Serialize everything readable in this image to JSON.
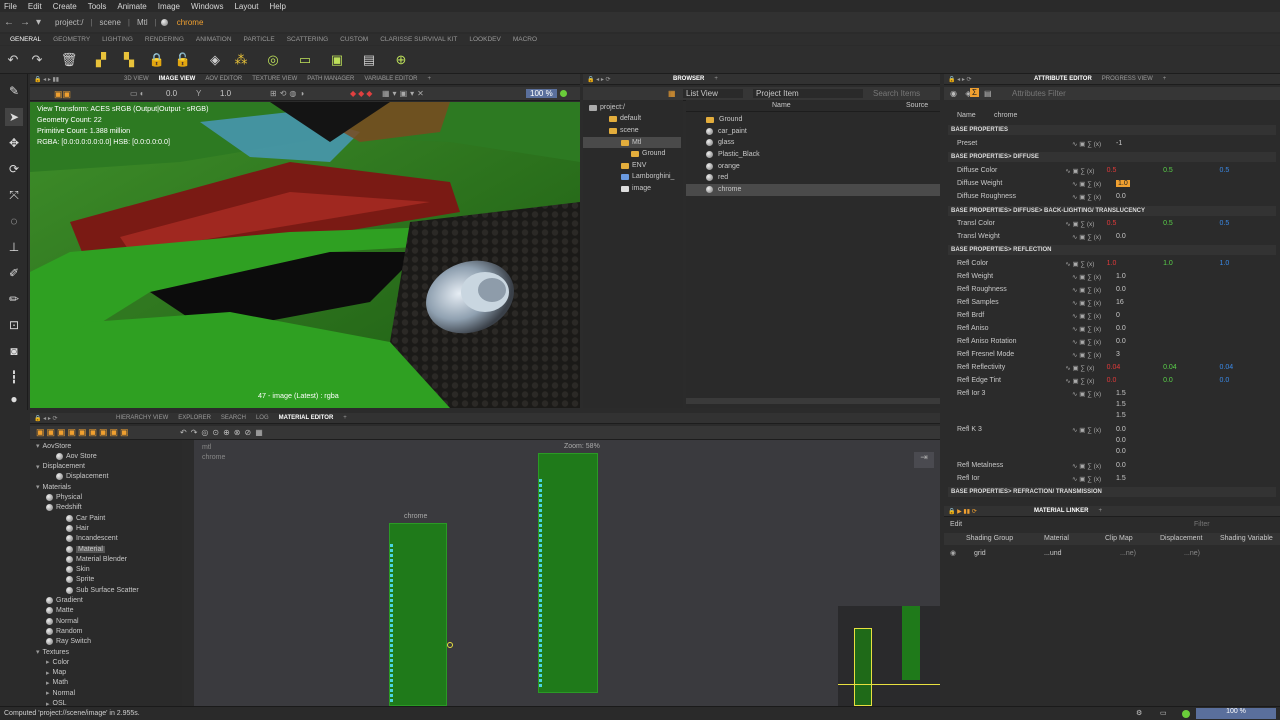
{
  "menu": [
    "File",
    "Edit",
    "Create",
    "Tools",
    "Animate",
    "Image",
    "Windows",
    "Layout",
    "Help"
  ],
  "path": {
    "crumbs": [
      "project:/",
      "scene",
      "Mtl"
    ],
    "selected": "chrome"
  },
  "shelf_tabs": [
    "GENERAL",
    "GEOMETRY",
    "LIGHTING",
    "RENDERING",
    "ANIMATION",
    "PARTICLE",
    "SCATTERING",
    "CUSTOM",
    "CLARISSE SURVIVAL KIT",
    "LOOKDEV",
    "MACRO"
  ],
  "viewport": {
    "tabs": [
      "3D VIEW",
      "IMAGE VIEW",
      "AOV EDITOR",
      "TEXTURE VIEW",
      "PATH MANAGER",
      "VARIABLE EDITOR"
    ],
    "field1": "0.0",
    "field2": "1.0",
    "zoom": "100 %",
    "info_lines": [
      "View Transform: ACES sRGB (Output|Output - sRGB)",
      "Geometry Count: 22",
      "Primitive Count: 1.388 million",
      "RGBA: [0.0:0.0:0.0:0.0] HSB: [0.0:0.0:0.0]"
    ],
    "caption": "47 - image (Latest) : rgba"
  },
  "browser": {
    "tab": "BROWSER",
    "list_view": "List View",
    "project_item": "Project Item",
    "search_placeholder": "Search Items",
    "col_name": "Name",
    "col_source": "Source",
    "tree": [
      "project:/",
      "default",
      "scene",
      "Mtl",
      "Ground",
      "ENV",
      "Lamborghini_",
      "image"
    ],
    "items": [
      "Ground",
      "car_paint",
      "glass",
      "Plastic_Black",
      "orange",
      "red",
      "chrome"
    ]
  },
  "attr": {
    "tabs": [
      "ATTRIBUTE EDITOR",
      "PROGRESS VIEW"
    ],
    "filter_placeholder": "Attributes Filter",
    "name_label": "Name",
    "name_value": "chrome",
    "sections": [
      "BASE PROPERTIES",
      "BASE PROPERTIES> DIFFUSE",
      "BASE PROPERTIES> DIFFUSE> BACK-LIGHTING/ TRANSLUCENCY",
      "BASE PROPERTIES> REFLECTION",
      "BASE PROPERTIES> REFRACTION/ TRANSMISSION"
    ],
    "rows": [
      {
        "label": "Preset",
        "v": "-1"
      },
      {
        "label": "Diffuse Color",
        "r": "0.5",
        "g": "0.5",
        "b": "0.5"
      },
      {
        "label": "Diffuse Weight",
        "v": "1.0"
      },
      {
        "label": "Diffuse Roughness",
        "v": "0.0"
      },
      {
        "label": "Transl Color",
        "r": "0.5",
        "g": "0.5",
        "b": "0.5"
      },
      {
        "label": "Transl Weight",
        "v": "0.0"
      },
      {
        "label": "Refl Color",
        "r": "1.0",
        "g": "1.0",
        "b": "1.0"
      },
      {
        "label": "Refl Weight",
        "v": "1.0"
      },
      {
        "label": "Refl Roughness",
        "v": "0.0"
      },
      {
        "label": "Refl Samples",
        "v": "16"
      },
      {
        "label": "Refl Brdf",
        "v": "0"
      },
      {
        "label": "Refl Aniso",
        "v": "0.0"
      },
      {
        "label": "Refl Aniso Rotation",
        "v": "0.0"
      },
      {
        "label": "Refl Fresnel Mode",
        "v": "3"
      },
      {
        "label": "Refl Reflectivity",
        "r": "0.04",
        "g": "0.04",
        "b": "0.04"
      },
      {
        "label": "Refl Edge Tint",
        "r": "0.0",
        "g": "0.0",
        "b": "0.0"
      },
      {
        "label": "Refl Ior 3",
        "v": "1.5",
        "v2": "1.5",
        "v3": "1.5"
      },
      {
        "label": "Refl K 3",
        "v": "0.0",
        "v2": "0.0",
        "v3": "0.0"
      },
      {
        "label": "Refl Metalness",
        "v": "0.0"
      },
      {
        "label": "Refl Ior",
        "v": "1.5"
      }
    ]
  },
  "linker": {
    "tab": "MATERIAL LINKER",
    "edit": "Edit",
    "filter_placeholder": "Filter",
    "cols": [
      "Shading Group",
      "Material",
      "Clip Map",
      "Displacement",
      "Shading Variable"
    ],
    "row": {
      "group": "grid",
      "material": "...und",
      "clip": "...ne)",
      "disp": "...ne)"
    }
  },
  "material_editor": {
    "tabs": [
      "HIERARCHY VIEW",
      "EXPLORER",
      "SEARCH",
      "LOG",
      "MATERIAL EDITOR"
    ],
    "tree": [
      {
        "t": "AovStore",
        "d": 0
      },
      {
        "t": "Aov Store",
        "d": 2
      },
      {
        "t": "Displacement",
        "d": 0
      },
      {
        "t": "Displacement",
        "d": 2
      },
      {
        "t": "Materials",
        "d": 0
      },
      {
        "t": "Physical",
        "d": 1
      },
      {
        "t": "Redshift",
        "d": 1
      },
      {
        "t": "Car Paint",
        "d": 3
      },
      {
        "t": "Hair",
        "d": 3
      },
      {
        "t": "Incandescent",
        "d": 3
      },
      {
        "t": "Material",
        "d": 3
      },
      {
        "t": "Material Blender",
        "d": 3
      },
      {
        "t": "Skin",
        "d": 3
      },
      {
        "t": "Sprite",
        "d": 3
      },
      {
        "t": "Sub Surface Scatter",
        "d": 3
      },
      {
        "t": "Gradient",
        "d": 1
      },
      {
        "t": "Matte",
        "d": 1
      },
      {
        "t": "Normal",
        "d": 1
      },
      {
        "t": "Random",
        "d": 1
      },
      {
        "t": "Ray Switch",
        "d": 1
      },
      {
        "t": "Textures",
        "d": 0
      },
      {
        "t": "Color",
        "d": 1
      },
      {
        "t": "Map",
        "d": 1
      },
      {
        "t": "Math",
        "d": 1
      },
      {
        "t": "Normal",
        "d": 1
      },
      {
        "t": "OSL",
        "d": 1
      }
    ],
    "graph_path": "mtl",
    "graph_sub": "chrome",
    "zoom": "Zoom: 58%",
    "node_label": "chrome"
  },
  "status": {
    "text": "Computed 'project://scene/image' in 2.955s.",
    "zoom": "100 %"
  }
}
